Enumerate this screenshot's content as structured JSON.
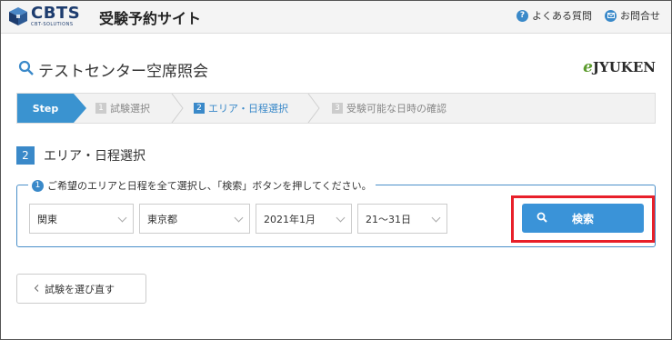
{
  "header": {
    "logo_text": "CBTS",
    "logo_sub": "CBT-SOLUTIONS",
    "site_title": "受験予約サイト",
    "faq_label": "よくある質問",
    "contact_label": "お問合せ"
  },
  "page": {
    "title": "テストセンター空席照会",
    "brand_e": "e",
    "brand_rest": "JYUKEN"
  },
  "steps": {
    "first_label": "Step",
    "items": [
      {
        "num": "1",
        "label": "試験選択"
      },
      {
        "num": "2",
        "label": "エリア・日程選択"
      },
      {
        "num": "3",
        "label": "受験可能な日時の確認"
      }
    ]
  },
  "section": {
    "num": "2",
    "title": "エリア・日程選択",
    "instruction_num": "1",
    "instruction": "ご希望のエリアと日程を全て選択し、「検索」ボタンを押してください。"
  },
  "selects": {
    "region": "関東",
    "prefecture": "東京都",
    "month": "2021年1月",
    "days": "21～31日"
  },
  "buttons": {
    "search": "検索",
    "back": "試験を選び直す"
  },
  "colors": {
    "accent": "#3a89c9",
    "highlight": "#e8202a"
  }
}
